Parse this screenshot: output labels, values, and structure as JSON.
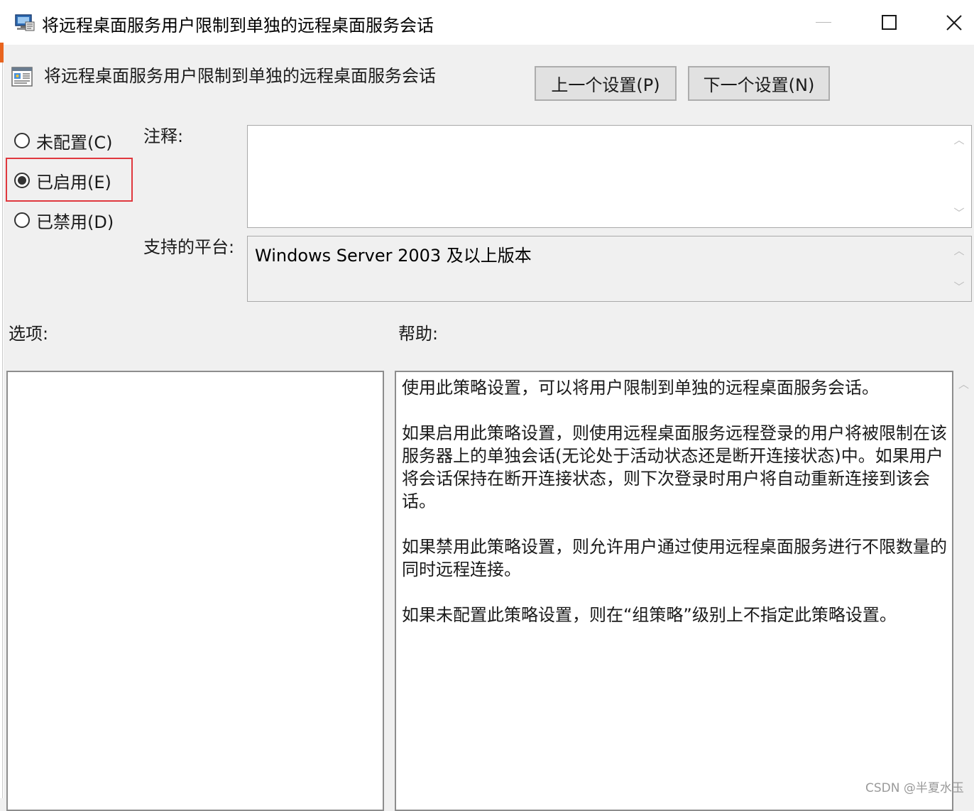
{
  "window": {
    "title": "将远程桌面服务用户限制到单独的远程桌面服务会话"
  },
  "header": {
    "policy_title": "将远程桌面服务用户限制到单独的远程桌面服务会话",
    "prev_button": "上一个设置(P)",
    "next_button": "下一个设置(N)"
  },
  "state": {
    "options": [
      {
        "label": "未配置(C)",
        "selected": false
      },
      {
        "label": "已启用(E)",
        "selected": true
      },
      {
        "label": "已禁用(D)",
        "selected": false
      }
    ]
  },
  "comment": {
    "label": "注释:",
    "value": ""
  },
  "platform": {
    "label": "支持的平台:",
    "value": "Windows Server 2003 及以上版本"
  },
  "options_section": {
    "label": "选项:"
  },
  "help_section": {
    "label": "帮助:",
    "paragraphs": [
      "使用此策略设置，可以将用户限制到单独的远程桌面服务会话。",
      "如果启用此策略设置，则使用远程桌面服务远程登录的用户将被限制在该服务器上的单独会话(无论处于活动状态还是断开连接状态)中。如果用户将会话保持在断开连接状态，则下次登录时用户将自动重新连接到该会话。",
      "如果禁用此策略设置，则允许用户通过使用远程桌面服务进行不限数量的同时远程连接。",
      "如果未配置此策略设置，则在“组策略”级别上不指定此策略设置。"
    ]
  },
  "watermark": "CSDN @半夏水玉",
  "icons": {
    "app": "group-policy-computer-icon",
    "policy": "policy-setting-icon",
    "close": "close-icon",
    "maximize": "maximize-icon",
    "minimize": "minimize-icon",
    "scroll_up": "chevron-up-icon",
    "scroll_down": "chevron-down-icon"
  },
  "colors": {
    "highlight_border": "#e0383e",
    "dialog_bg": "#f0f0f0",
    "button_bg": "#e1e1e1"
  }
}
